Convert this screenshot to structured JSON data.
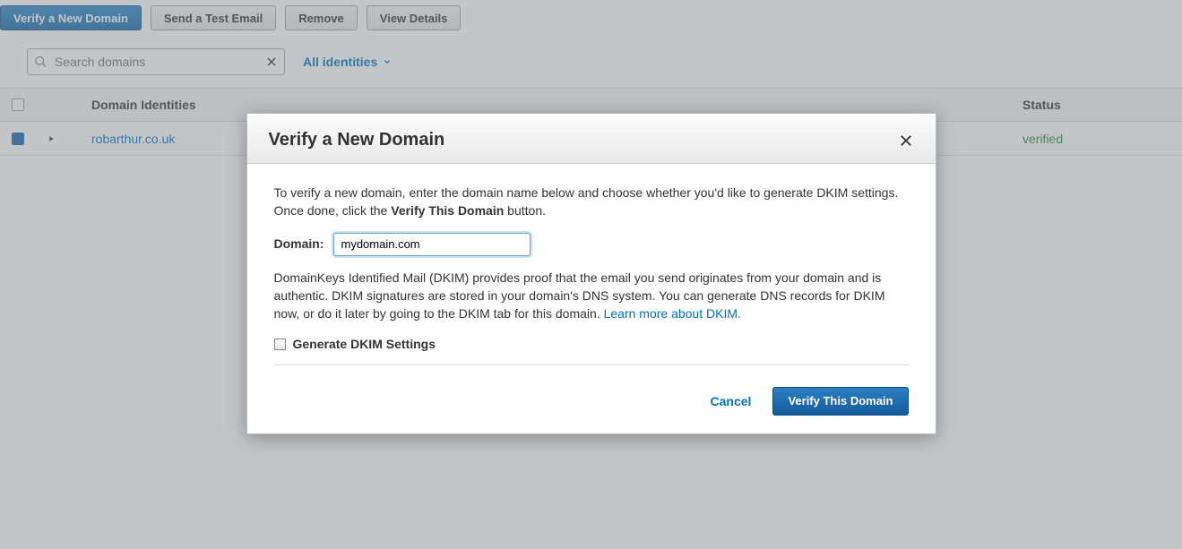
{
  "toolbar": {
    "verify_new_domain": "Verify a New Domain",
    "send_test_email": "Send a Test Email",
    "remove": "Remove",
    "view_details": "View Details"
  },
  "search": {
    "placeholder": "Search domains"
  },
  "filter": {
    "label": "All identities"
  },
  "table": {
    "headers": {
      "domain": "Domain Identities",
      "status": "Status"
    },
    "rows": [
      {
        "domain": "robarthur.co.uk",
        "status": "verified"
      }
    ]
  },
  "modal": {
    "title": "Verify a New Domain",
    "intro_a": "To verify a new domain, enter the domain name below and choose whether you'd like to generate DKIM settings. Once done, click the ",
    "intro_bold": "Verify This Domain",
    "intro_b": " button.",
    "domain_label": "Domain:",
    "domain_value": "mydomain.com",
    "dkim_text": "DomainKeys Identified Mail (DKIM) provides proof that the email you send originates from your domain and is authentic. DKIM signatures are stored in your domain's DNS system. You can generate DNS records for DKIM now, or do it later by going to the DKIM tab for this domain. ",
    "dkim_link": "Learn more about DKIM.",
    "generate_dkim": "Generate DKIM Settings",
    "cancel": "Cancel",
    "verify_btn": "Verify This Domain"
  }
}
